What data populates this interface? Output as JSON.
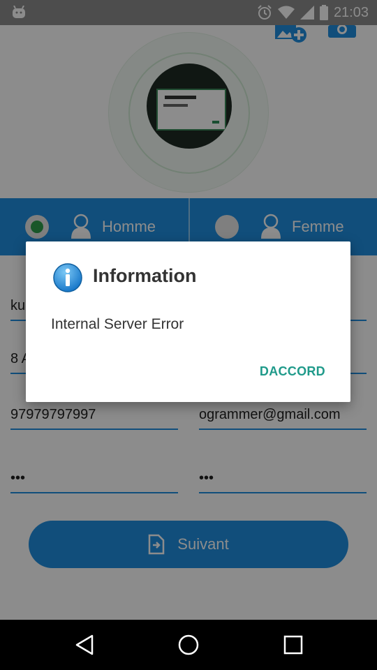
{
  "status_bar": {
    "time": "21:03",
    "icons": [
      "android-icon",
      "alarm-icon",
      "wifi-icon",
      "signal-icon",
      "battery-icon"
    ]
  },
  "app": {
    "header_icons": [
      "add-photo-icon",
      "camera-icon"
    ],
    "gender": {
      "male_label": "Homme",
      "female_label": "Femme",
      "selected": "male"
    },
    "fields": {
      "name": "ku",
      "address": "8 A",
      "phone": "97979797997",
      "email": "ogrammer@gmail.com",
      "password": "•••",
      "confirm_password": "•••"
    },
    "next_button": "Suivant"
  },
  "dialog": {
    "title": "Information",
    "message": "Internal Server Error",
    "button": "DACCORD",
    "accent_color": "#1f9a8a"
  },
  "nav_bar": {
    "buttons": [
      "back-icon",
      "home-icon",
      "recents-icon"
    ]
  }
}
